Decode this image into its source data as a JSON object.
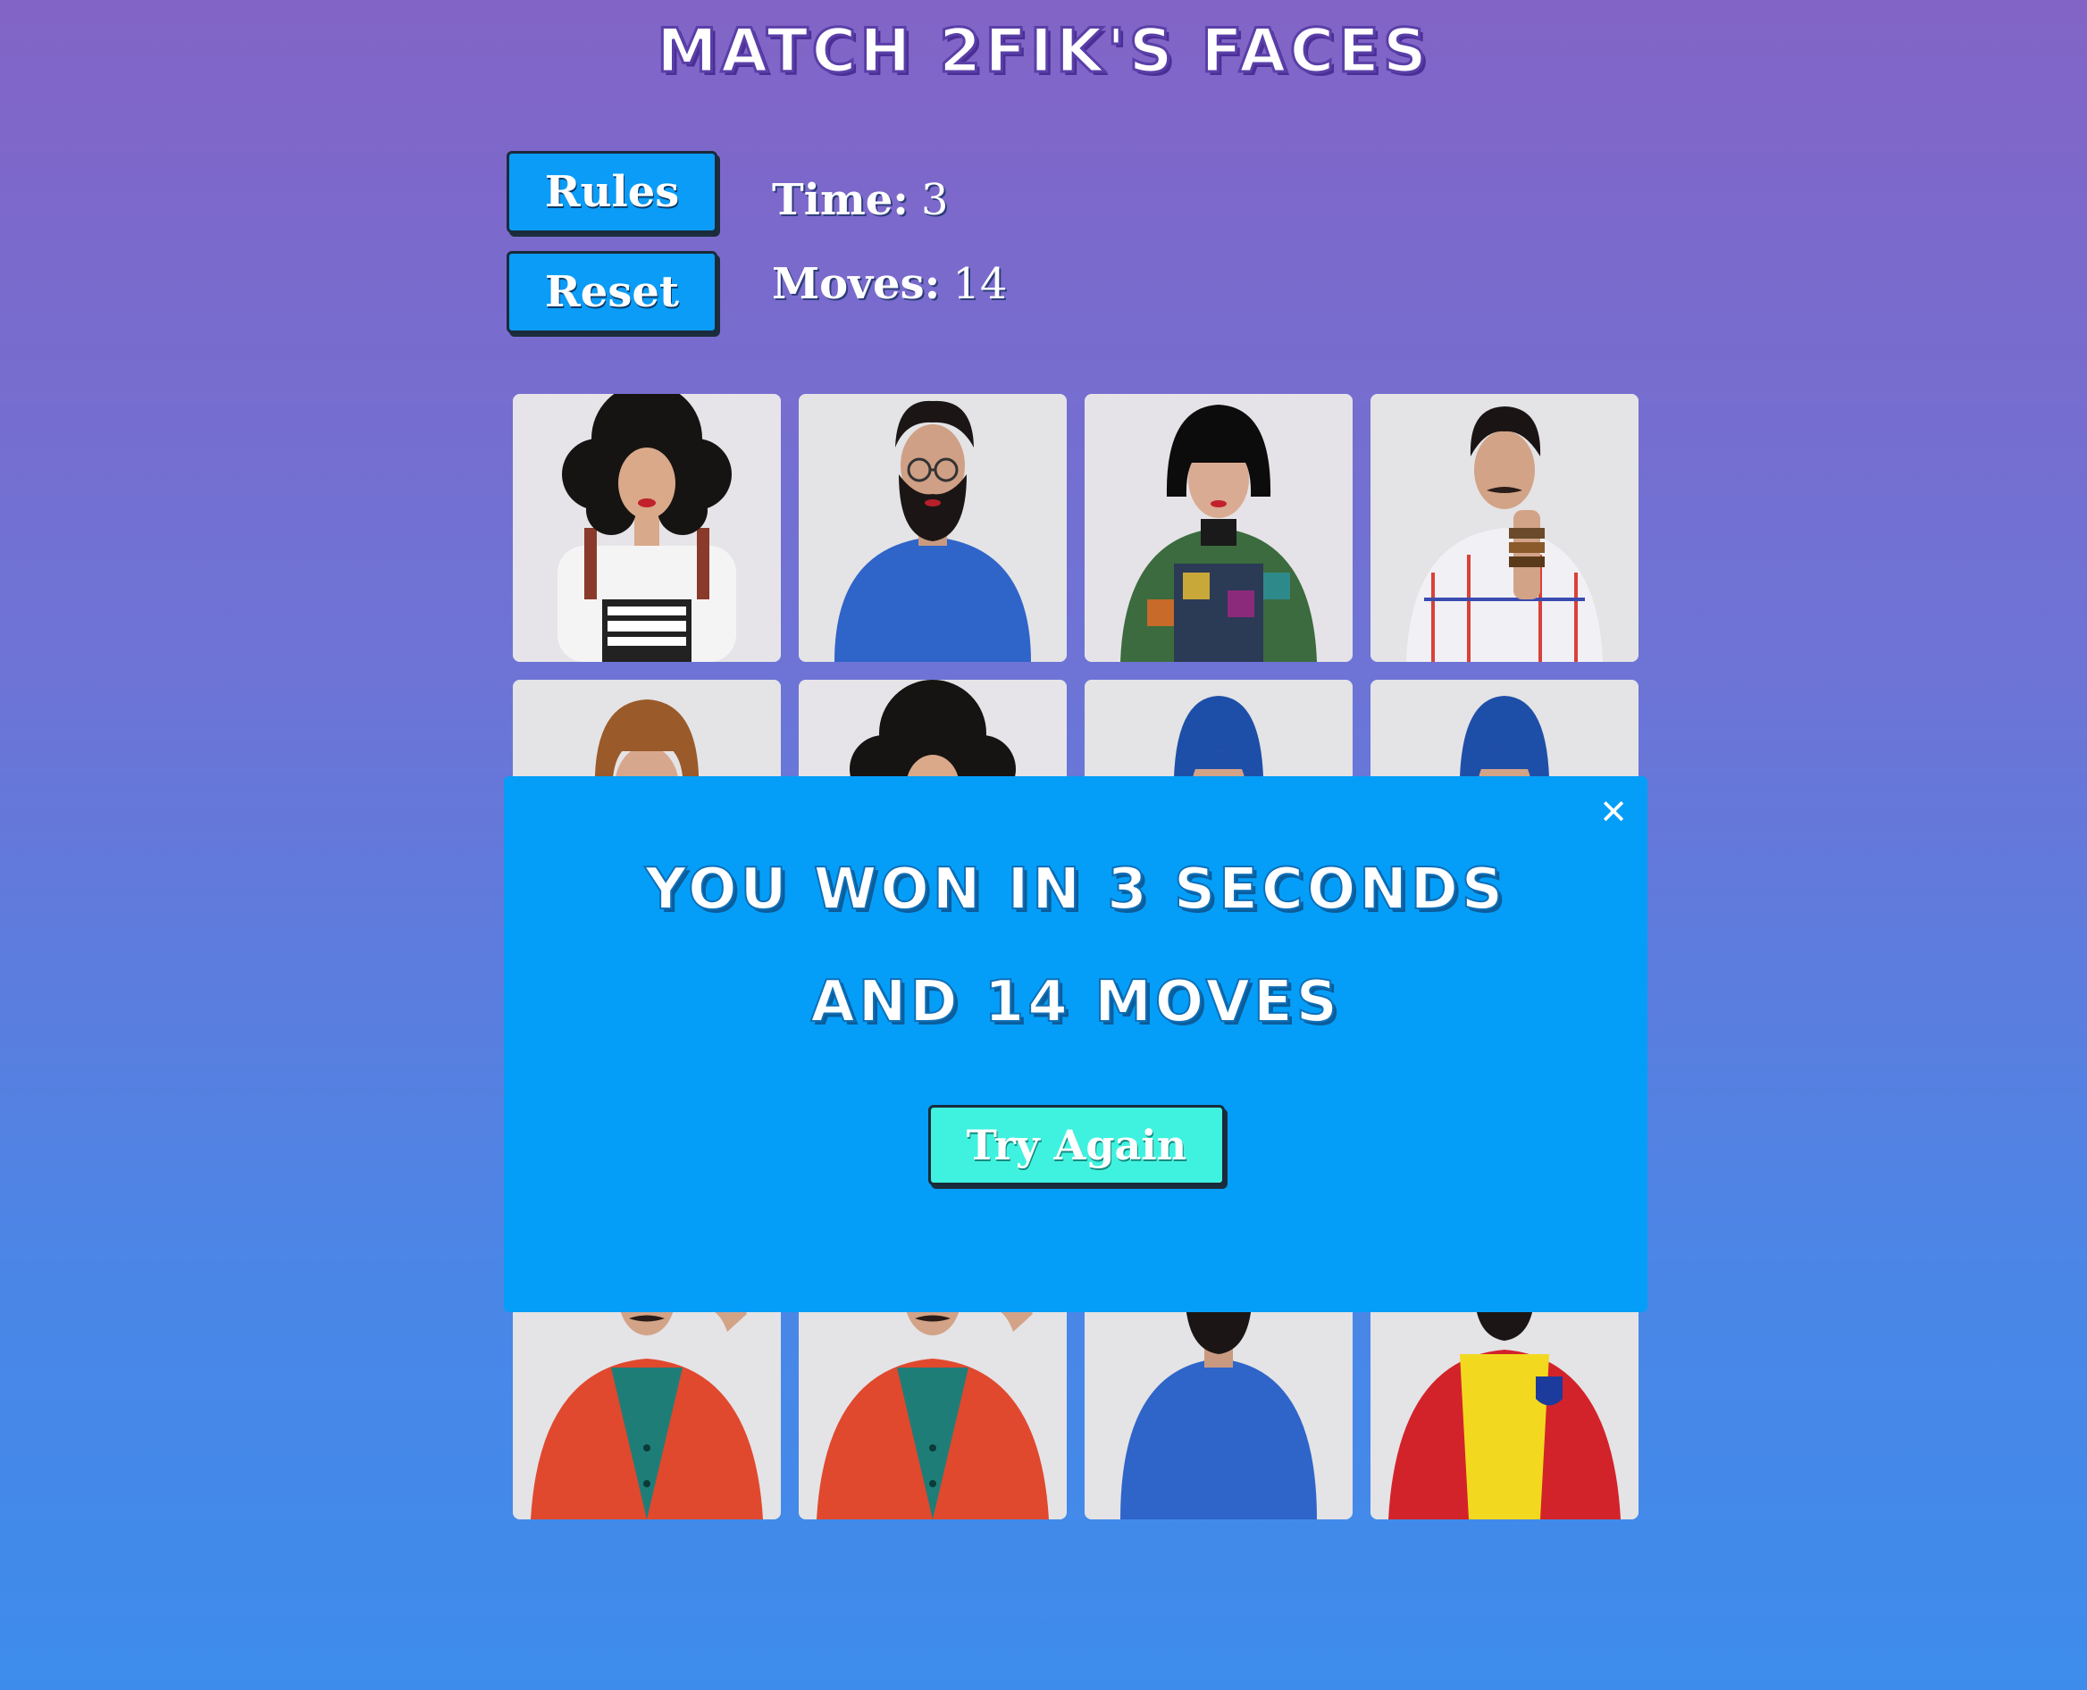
{
  "page_title": "Match 2fik's Faces",
  "controls": {
    "rules_label": "Rules",
    "reset_label": "Reset",
    "time_label": "Time:",
    "time_value": "3",
    "moves_label": "Moves:",
    "moves_value": "14"
  },
  "cards": [
    {
      "face": "afro-wig-parental-advisory-tee"
    },
    {
      "face": "bearded-glasses-blue-shirt"
    },
    {
      "face": "black-bob-wig-patterned-jacket"
    },
    {
      "face": "mustache-white-outfit-bracelets"
    },
    {
      "face": "brown-bob-wig"
    },
    {
      "face": "afro-wig"
    },
    {
      "face": "blue-headscarf"
    },
    {
      "face": "blue-headscarf"
    },
    {
      "face": "hidden"
    },
    {
      "face": "hidden"
    },
    {
      "face": "hidden"
    },
    {
      "face": "hidden"
    },
    {
      "face": "red-jacket-teal-shirt"
    },
    {
      "face": "red-jacket-teal-shirt"
    },
    {
      "face": "bearded-glasses-blue-shirt"
    },
    {
      "face": "red-jacket-yellow-jersey"
    }
  ],
  "modal": {
    "line1": "You won in 3 seconds",
    "line2": "and 14 moves",
    "try_again_label": "Try Again",
    "close_icon": "close-icon"
  },
  "colors": {
    "button_blue": "#0a9cf7",
    "modal_blue": "#049ef8",
    "try_again_teal": "#3ff2df"
  }
}
